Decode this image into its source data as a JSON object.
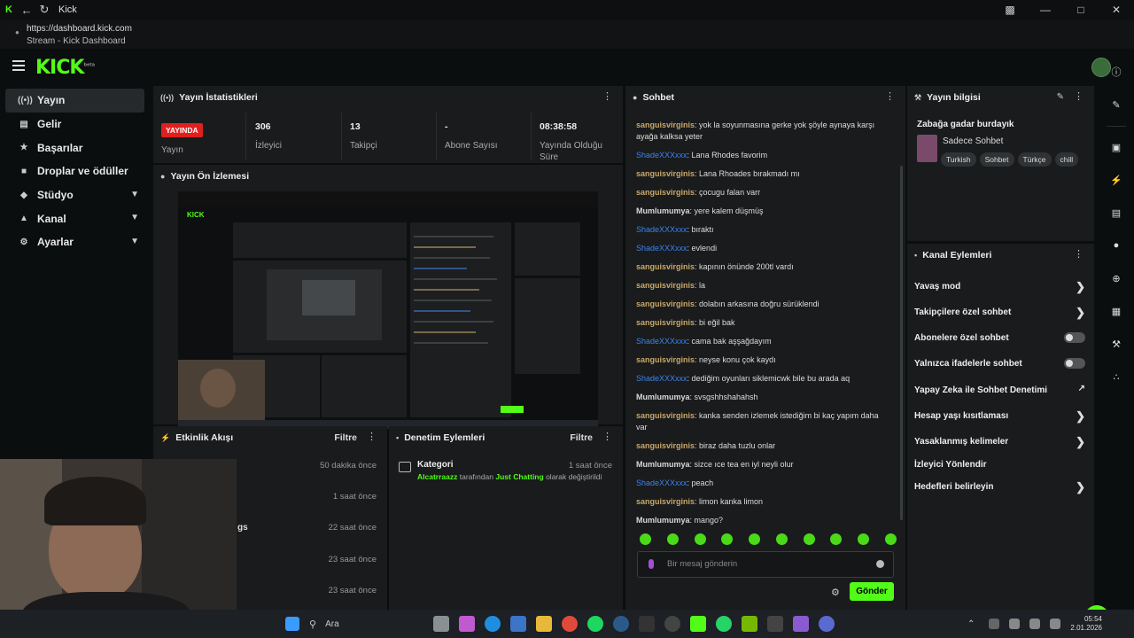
{
  "browser": {
    "tab_title": "Kick",
    "url": "https://dashboard.kick.com",
    "page_title": "Stream - Kick Dashboard"
  },
  "app": {
    "logo": "KICK",
    "logo_sup": "beta"
  },
  "sidebar": {
    "items": [
      {
        "label": "Yayın",
        "icon": "broadcast-icon"
      },
      {
        "label": "Gelir",
        "icon": "revenue-icon"
      },
      {
        "label": "Başarılar",
        "icon": "trophy-icon"
      },
      {
        "label": "Droplar ve ödüller",
        "icon": "gift-icon"
      },
      {
        "label": "Stüdyo",
        "icon": "studio-icon"
      },
      {
        "label": "Kanal",
        "icon": "channel-icon"
      },
      {
        "label": "Ayarlar",
        "icon": "gear-icon"
      }
    ]
  },
  "stats": {
    "title": "Yayın İstatistikleri",
    "live_badge": "YAYINDA",
    "live_label": "Yayın",
    "viewers_value": "306",
    "viewers_label": "İzleyici",
    "followers_value": "13",
    "followers_label": "Takipçi",
    "subs_value": "-",
    "subs_label": "Abone Sayısı",
    "duration_value": "08:38:58",
    "duration_label": "Yayında Olduğu Süre"
  },
  "preview": {
    "title": "Yayın Ön İzlemesi"
  },
  "activity": {
    "title": "Etkinlik Akışı",
    "filter": "Filtre",
    "rows": [
      "50 dakika önce",
      "1 saat önce",
      "22 saat önce",
      "23 saat önce",
      "23 saat önce"
    ],
    "partial_text": "gs"
  },
  "moderation": {
    "title": "Denetim Eylemleri",
    "filter": "Filtre",
    "item_title": "Kategori",
    "item_time": "1 saat önce",
    "item_user": "Alcatrraazz",
    "item_mid": "tarafından",
    "item_category": "Just Chatting",
    "item_tail": "olarak değiştirildi"
  },
  "chat": {
    "title": "Sohbet",
    "messages": [
      {
        "user": "sanguisvirginis",
        "type": 1,
        "text": ": yok la soyunmasına gerke yok şöyle aynaya karşı ayağa kalksa yeter"
      },
      {
        "user": "ShadeXXXxxx",
        "type": 2,
        "text": ": Lana Rhodes favorim"
      },
      {
        "user": "sanguisvirginis",
        "type": 1,
        "text": ": Lana Rhoades bırakmadı mı"
      },
      {
        "user": "sanguisvirginis",
        "type": 1,
        "text": ": çocugu falan varr"
      },
      {
        "user": "Mumlumumya",
        "type": 3,
        "text": ": yere kalem düşmüş"
      },
      {
        "user": "ShadeXXXxxx",
        "type": 2,
        "text": ": bıraktı"
      },
      {
        "user": "ShadeXXXxxx",
        "type": 2,
        "text": ": evlendi"
      },
      {
        "user": "sanguisvirginis",
        "type": 1,
        "text": ": kapının önünde 200tl vardı"
      },
      {
        "user": "sanguisvirginis",
        "type": 1,
        "text": ": la"
      },
      {
        "user": "sanguisvirginis",
        "type": 1,
        "text": ": dolabın arkasına doğru sürüklendi"
      },
      {
        "user": "sanguisvirginis",
        "type": 1,
        "text": ": bi eğil bak"
      },
      {
        "user": "ShadeXXXxxx",
        "type": 2,
        "text": ": cama bak aşşağdayım"
      },
      {
        "user": "sanguisvirginis",
        "type": 1,
        "text": ": neyse konu çok kaydı"
      },
      {
        "user": "ShadeXXXxxx",
        "type": 2,
        "text": ": dediğim oyunları siklemicwk bile bu arada aq"
      },
      {
        "user": "Mumlumumya",
        "type": 3,
        "text": ": svsgshhshahahsh"
      },
      {
        "user": "sanguisvirginis",
        "type": 1,
        "text": ": kanka senden izlemek istediğim bi kaç yapım daha var"
      },
      {
        "user": "sanguisvirginis",
        "type": 1,
        "text": ": biraz daha tuzlu onlar"
      },
      {
        "user": "Mumlumumya",
        "type": 3,
        "text": ": sizce ıce tea en iyl neyli olur"
      },
      {
        "user": "ShadeXXXxxx",
        "type": 2,
        "text": ": peach"
      },
      {
        "user": "sanguisvirginis",
        "type": 1,
        "text": ": limon kanka limon"
      },
      {
        "user": "Mumlumumya",
        "type": 3,
        "text": ": mango?"
      }
    ],
    "input_placeholder": "Bir mesaj gönderin",
    "send_label": "Gönder"
  },
  "stream_info": {
    "title": "Yayın bilgisi",
    "stream_title": "Zabağa gadar burdayık",
    "category": "Sadece Sohbet",
    "tags": [
      "Turkish",
      "Sohbet",
      "Türkçe",
      "chill"
    ]
  },
  "channel_actions": {
    "title": "Kanal Eylemleri",
    "items": [
      {
        "label": "Yavaş mod",
        "control": "chevron"
      },
      {
        "label": "Takipçilere özel sohbet",
        "control": "chevron"
      },
      {
        "label": "Abonelere özel sohbet",
        "control": "toggle"
      },
      {
        "label": "Yalnızca ifadelerle sohbet",
        "control": "toggle"
      },
      {
        "label": "Yapay Zeka ile Sohbet Denetimi",
        "control": "external"
      },
      {
        "label": "Hesap yaşı kısıtlaması",
        "control": "chevron"
      },
      {
        "label": "Yasaklanmış kelimeler",
        "control": "chevron"
      },
      {
        "label": "İzleyici Yönlendir",
        "control": "none"
      },
      {
        "label": "Hedefleri belirleyin",
        "control": "chevron"
      }
    ]
  },
  "taskbar": {
    "search_label": "Ara",
    "time": "05:54",
    "date": "2.01.2026"
  },
  "colors": {
    "accent": "#53fc18",
    "live": "#e0201e",
    "panel": "#191b1c",
    "background": "#0b0e0f",
    "user_gold": "#c9a86a",
    "user_blue": "#3c82f0"
  }
}
